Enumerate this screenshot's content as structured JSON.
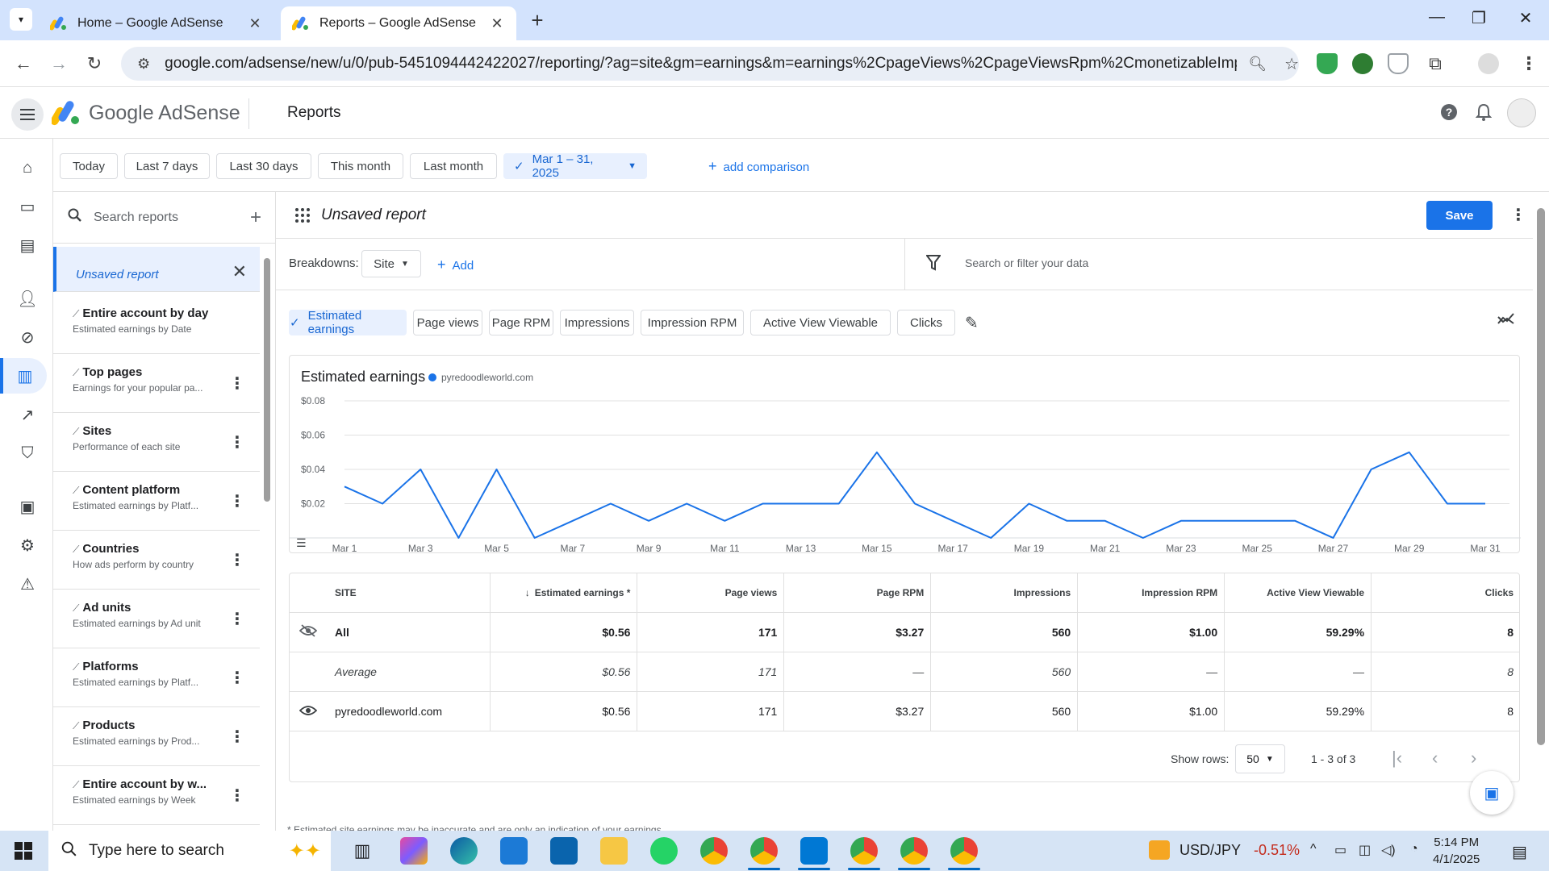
{
  "browser": {
    "tabs": [
      {
        "title": "Home – Google AdSense",
        "active": false
      },
      {
        "title": "Reports – Google AdSense",
        "active": true
      }
    ],
    "url": "google.com/adsense/new/u/0/pub-5451094442422027/reporting/?ag=site&gm=earnings&m=earnings%2CpageViews%2CpageViewsRpm%2CmonetizableImpressions..."
  },
  "header": {
    "brand": "Google AdSense",
    "page_title": "Reports"
  },
  "date_ranges": [
    "Today",
    "Last 7 days",
    "Last 30 days",
    "This month",
    "Last month"
  ],
  "selected_range": "Mar 1 – 31, 2025",
  "add_comparison": "add comparison",
  "reports_panel": {
    "search_placeholder": "Search reports",
    "active_report": "Unsaved report",
    "items": [
      {
        "title": "Entire account by day",
        "subtitle": "Estimated earnings by Date"
      },
      {
        "title": "Top pages",
        "subtitle": "Earnings for your popular pa..."
      },
      {
        "title": "Sites",
        "subtitle": "Performance of each site"
      },
      {
        "title": "Content platform",
        "subtitle": "Estimated earnings by Platf..."
      },
      {
        "title": "Countries",
        "subtitle": "How ads perform by country"
      },
      {
        "title": "Ad units",
        "subtitle": "Estimated earnings by Ad unit"
      },
      {
        "title": "Platforms",
        "subtitle": "Estimated earnings by Platf..."
      },
      {
        "title": "Products",
        "subtitle": "Estimated earnings by Prod..."
      },
      {
        "title": "Entire account by w...",
        "subtitle": "Estimated earnings by Week"
      }
    ]
  },
  "report": {
    "name": "Unsaved report",
    "save_label": "Save",
    "breakdowns_label": "Breakdowns:",
    "breakdown_value": "Site",
    "add_label": "Add",
    "filter_placeholder": "Search or filter your data",
    "metrics": [
      "Estimated earnings",
      "Page views",
      "Page RPM",
      "Impressions",
      "Impression RPM",
      "Active View Viewable",
      "Clicks"
    ]
  },
  "chart_data": {
    "type": "line",
    "title": "Estimated earnings",
    "series": [
      {
        "name": "pyredoodleworld.com",
        "color": "#1a73e8",
        "values": [
          0.03,
          0.02,
          0.04,
          0.0,
          0.04,
          0.0,
          0.01,
          0.02,
          0.01,
          0.02,
          0.01,
          0.02,
          0.02,
          0.02,
          0.05,
          0.02,
          0.01,
          0.0,
          0.02,
          0.01,
          0.01,
          0.0,
          0.01,
          0.01,
          0.01,
          0.01,
          0.0,
          0.04,
          0.05,
          0.02,
          0.02
        ]
      }
    ],
    "x_tick_labels": [
      "Mar 1",
      "Mar 3",
      "Mar 5",
      "Mar 7",
      "Mar 9",
      "Mar 11",
      "Mar 13",
      "Mar 15",
      "Mar 17",
      "Mar 19",
      "Mar 21",
      "Mar 23",
      "Mar 25",
      "Mar 27",
      "Mar 29",
      "Mar 31"
    ],
    "y_tick_labels": [
      "$0.08",
      "$0.06",
      "$0.04",
      "$0.02"
    ],
    "ylim": [
      0,
      0.08
    ],
    "grid": true
  },
  "table": {
    "columns": [
      "SITE",
      "Estimated earnings *",
      "Page views",
      "Page RPM",
      "Impressions",
      "Impression RPM",
      "Active View Viewable",
      "Clicks"
    ],
    "rows": [
      {
        "type": "total",
        "cells": [
          "All",
          "$0.56",
          "171",
          "$3.27",
          "560",
          "$1.00",
          "59.29%",
          "8"
        ]
      },
      {
        "type": "avg",
        "cells": [
          "Average",
          "$0.56",
          "171",
          "—",
          "560",
          "—",
          "—",
          "8"
        ]
      },
      {
        "type": "site",
        "cells": [
          "pyredoodleworld.com",
          "$0.56",
          "171",
          "$3.27",
          "560",
          "$1.00",
          "59.29%",
          "8"
        ]
      }
    ],
    "show_rows_label": "Show rows:",
    "rows_per_page": "50",
    "range": "1 - 3 of 3"
  },
  "footnote": "* Estimated site earnings may be inaccurate and are only an indication of your earnings.",
  "taskbar": {
    "search_text": "Type here to search",
    "ticker_pair": "USD/JPY",
    "ticker_change": "-0.51%",
    "time": "5:14 PM",
    "date": "4/1/2025"
  }
}
